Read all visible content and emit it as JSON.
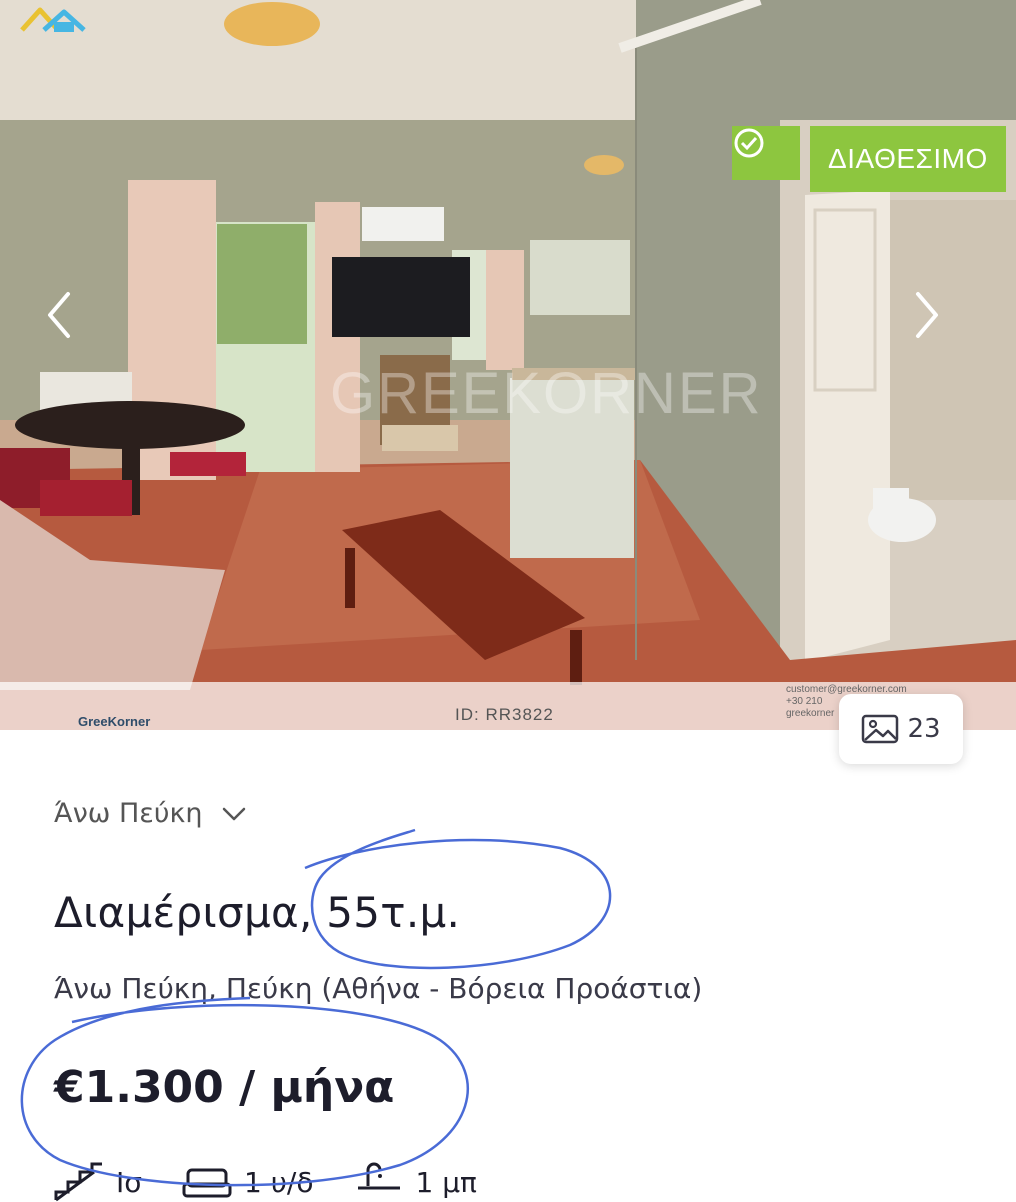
{
  "gallery": {
    "status_badge": "ΔΙΑΘΕΣΙΜΟ",
    "watermark": "GREEKORNER",
    "logo_text": "GreeKorner",
    "photo_id": "ID: RR3822",
    "contact_lines": [
      "customer@greekorner.com",
      "+30 210",
      "greekorner"
    ],
    "photo_count": "23",
    "accent_color": "#8dc63f"
  },
  "listing": {
    "area": "Άνω Πεύκη",
    "title": "Διαμέρισμα, 55τ.μ.",
    "address": "Άνω Πεύκη, Πεύκη (Αθήνα - Βόρεια Προάστια)",
    "price": "€1.300 / μήνα",
    "features": [
      {
        "icon": "stairs-icon",
        "label": "Ισ"
      },
      {
        "icon": "bed-icon",
        "label": "1 υ/δ"
      },
      {
        "icon": "shower-icon",
        "label": "1 μπ"
      }
    ]
  }
}
